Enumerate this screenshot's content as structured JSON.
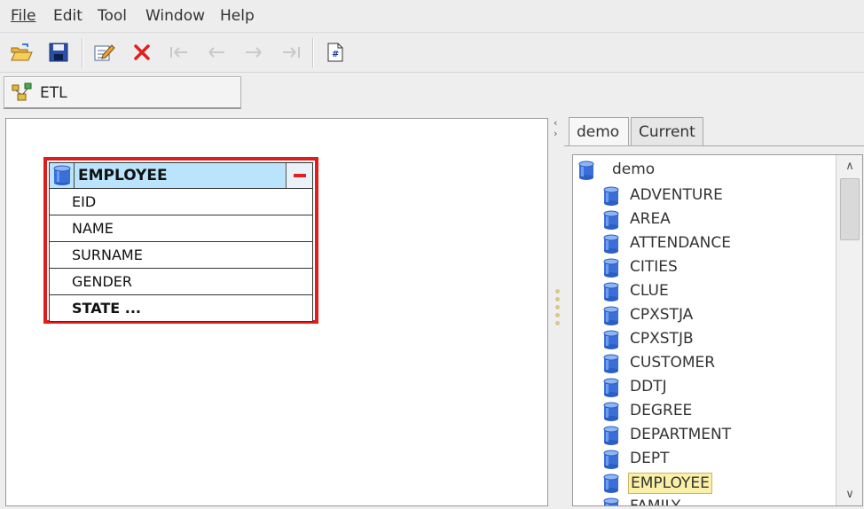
{
  "menu": {
    "file": "File",
    "edit": "Edit",
    "tool": "Tool",
    "window": "Window",
    "help": "Help"
  },
  "toolbar": {
    "icons": [
      "open-folder-icon",
      "save-icon",
      "edit-icon",
      "delete-icon",
      "first-icon",
      "previous-icon",
      "next-icon",
      "last-icon",
      "script-icon"
    ]
  },
  "etl_tab": {
    "label": "ETL"
  },
  "entity": {
    "title": "EMPLOYEE",
    "fields": [
      "EID",
      "NAME",
      "SURNAME",
      "GENDER",
      "STATE  ..."
    ]
  },
  "right_panel": {
    "tabs": [
      "demo",
      "Current"
    ],
    "root": "demo",
    "tables": [
      "ADVENTURE",
      "AREA",
      "ATTENDANCE",
      "CITIES",
      "CLUE",
      "CPXSTJA",
      "CPXSTJB",
      "CUSTOMER",
      "DDTJ",
      "DEGREE",
      "DEPARTMENT",
      "DEPT",
      "EMPLOYEE",
      "FAMILY"
    ],
    "selected": "EMPLOYEE"
  },
  "colors": {
    "highlight_border": "#e21b1b",
    "header_fill": "#b9e4fb",
    "selection": "#fbf0a8",
    "db_icon": "#3a6fd8"
  }
}
